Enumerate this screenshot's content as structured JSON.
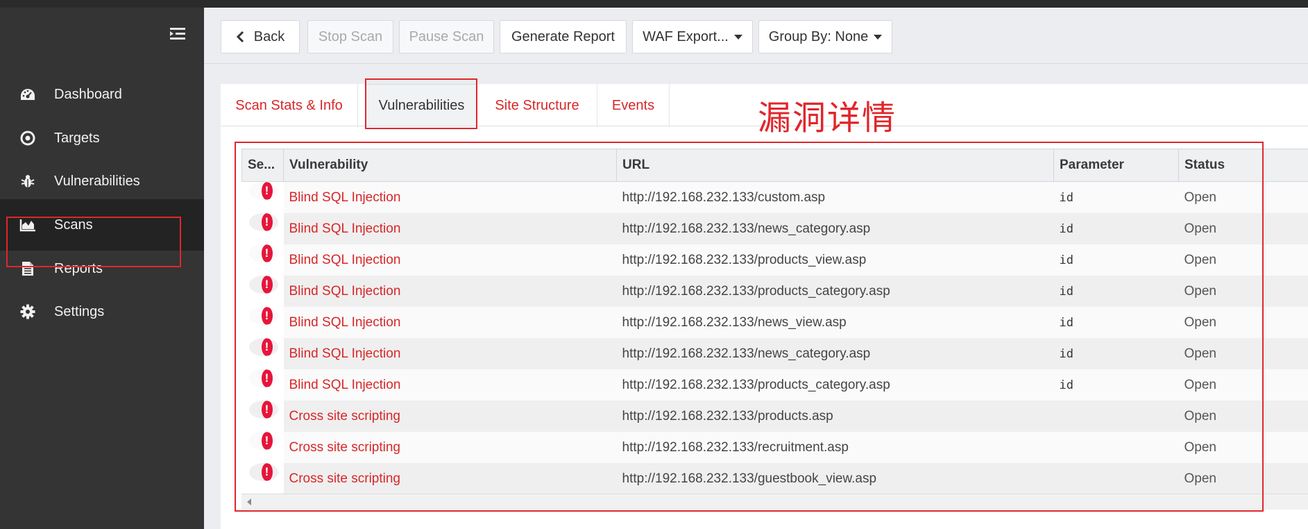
{
  "sidebar": {
    "items": [
      {
        "label": "Dashboard",
        "icon": "dashboard-icon"
      },
      {
        "label": "Targets",
        "icon": "target-icon"
      },
      {
        "label": "Vulnerabilities",
        "icon": "bug-icon"
      },
      {
        "label": "Scans",
        "icon": "area-chart-icon",
        "active": true
      },
      {
        "label": "Reports",
        "icon": "document-icon"
      },
      {
        "label": "Settings",
        "icon": "gear-icon"
      }
    ]
  },
  "toolbar": {
    "back": "Back",
    "stop_scan": "Stop Scan",
    "pause_scan": "Pause Scan",
    "generate_report": "Generate Report",
    "waf_export": "WAF Export...",
    "group_by": "Group By: None"
  },
  "tabs": [
    {
      "label": "Scan Stats & Info"
    },
    {
      "label": "Vulnerabilities",
      "active": true
    },
    {
      "label": "Site Structure"
    },
    {
      "label": "Events"
    }
  ],
  "annotation": "漏洞详情",
  "table": {
    "headers": [
      "Se...",
      "Vulnerability",
      "URL",
      "Parameter",
      "Status"
    ],
    "rows": [
      {
        "severity": "!",
        "vulnerability": "Blind SQL Injection",
        "url": "http://192.168.232.133/custom.asp",
        "parameter": "id",
        "status": "Open"
      },
      {
        "severity": "!",
        "vulnerability": "Blind SQL Injection",
        "url": "http://192.168.232.133/news_category.asp",
        "parameter": "id",
        "status": "Open"
      },
      {
        "severity": "!",
        "vulnerability": "Blind SQL Injection",
        "url": "http://192.168.232.133/products_view.asp",
        "parameter": "id",
        "status": "Open"
      },
      {
        "severity": "!",
        "vulnerability": "Blind SQL Injection",
        "url": "http://192.168.232.133/products_category.asp",
        "parameter": "id",
        "status": "Open"
      },
      {
        "severity": "!",
        "vulnerability": "Blind SQL Injection",
        "url": "http://192.168.232.133/news_view.asp",
        "parameter": "id",
        "status": "Open"
      },
      {
        "severity": "!",
        "vulnerability": "Blind SQL Injection",
        "url": "http://192.168.232.133/news_category.asp",
        "parameter": "id",
        "status": "Open"
      },
      {
        "severity": "!",
        "vulnerability": "Blind SQL Injection",
        "url": "http://192.168.232.133/products_category.asp",
        "parameter": "id",
        "status": "Open"
      },
      {
        "severity": "!",
        "vulnerability": "Cross site scripting",
        "url": "http://192.168.232.133/products.asp",
        "parameter": "",
        "status": "Open"
      },
      {
        "severity": "!",
        "vulnerability": "Cross site scripting",
        "url": "http://192.168.232.133/recruitment.asp",
        "parameter": "",
        "status": "Open"
      },
      {
        "severity": "!",
        "vulnerability": "Cross site scripting",
        "url": "http://192.168.232.133/guestbook_view.asp",
        "parameter": "",
        "status": "Open"
      }
    ]
  },
  "colors": {
    "accent_red": "#d82628",
    "severity_high": "#e6153a",
    "sidebar_bg": "#343434"
  }
}
